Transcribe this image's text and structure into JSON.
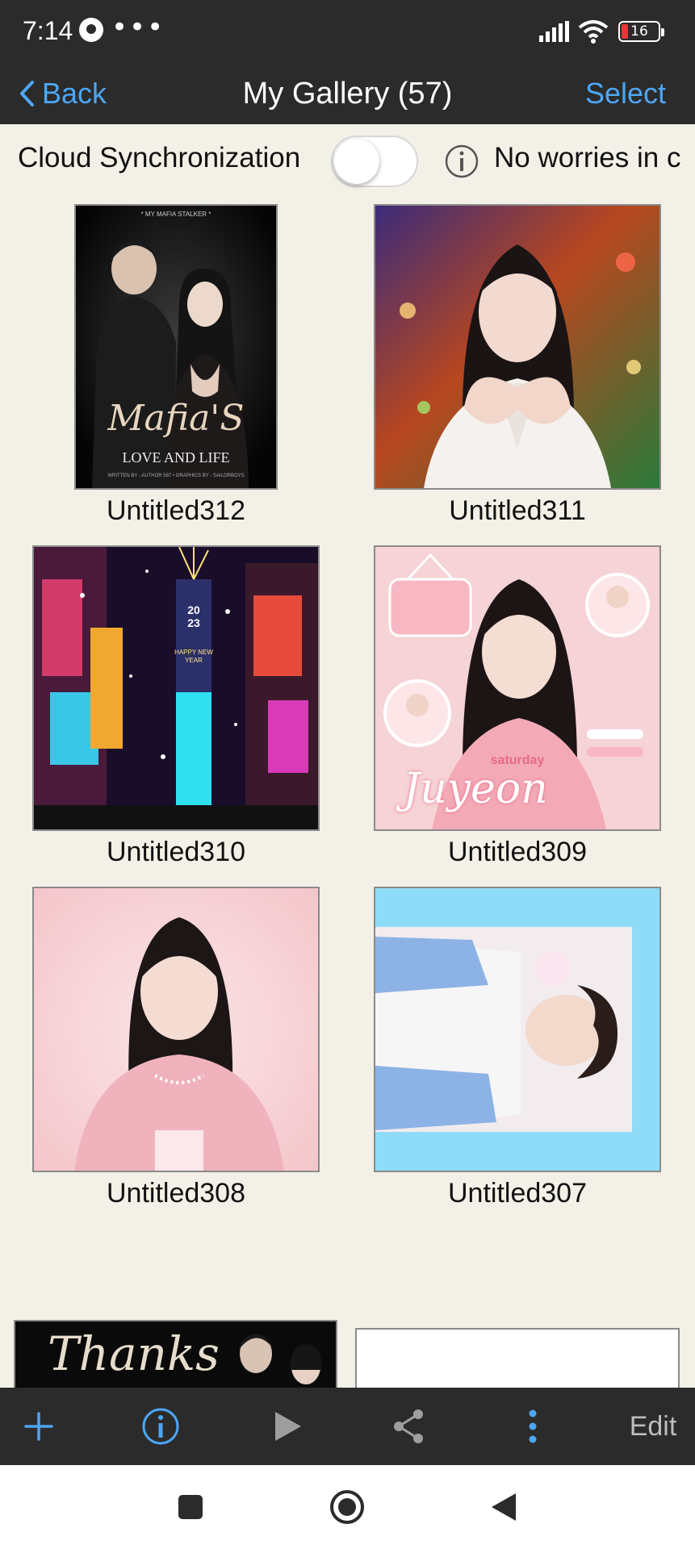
{
  "status_bar": {
    "time": "7:14",
    "battery": "16",
    "more_indicator": "•••"
  },
  "nav": {
    "back_label": "Back",
    "title": "My Gallery (57)",
    "select_label": "Select"
  },
  "sync": {
    "label": "Cloud Synchronization",
    "enabled": false,
    "note": "No worries in c"
  },
  "gallery": {
    "items": [
      {
        "name": "Untitled312",
        "thumb": "poster-mafias-love-and-life"
      },
      {
        "name": "Untitled311",
        "thumb": "portrait-heart-hands"
      },
      {
        "name": "Untitled310",
        "thumb": "times-square-2023-fireworks"
      },
      {
        "name": "Untitled309",
        "thumb": "pink-edit-juyeon"
      },
      {
        "name": "Untitled308",
        "thumb": "pink-portrait"
      },
      {
        "name": "Untitled307",
        "thumb": "blue-frame-portrait"
      },
      {
        "name": "",
        "thumb": "thanks-banner"
      },
      {
        "name": "",
        "thumb": "blank-white"
      }
    ],
    "thumb_text": {
      "poster_small_title": "* MY MAFIA STALKER *",
      "poster_script": "Mafia'S",
      "poster_subtitle": "LOVE AND LIFE",
      "poster_credits": "WRITTEN BY - AUTHOR 587 • GRAPHICS BY - SAILORBOYS",
      "year_top": "20",
      "year_bottom": "23",
      "happy_new_year": "HAPPY NEW YEAR",
      "saturday": "saturday",
      "juyeon": "Juyeon",
      "thanks": "Thanks"
    }
  },
  "toolbar": {
    "add_icon": "plus-icon",
    "info_icon": "info-icon",
    "play_icon": "play-icon",
    "share_icon": "share-icon",
    "more_icon": "vertical-dots-icon",
    "edit_label": "Edit"
  },
  "colors": {
    "accent": "#4da6f5",
    "bar_bg": "#2b2b2b",
    "page_bg": "#f3f1e7"
  }
}
